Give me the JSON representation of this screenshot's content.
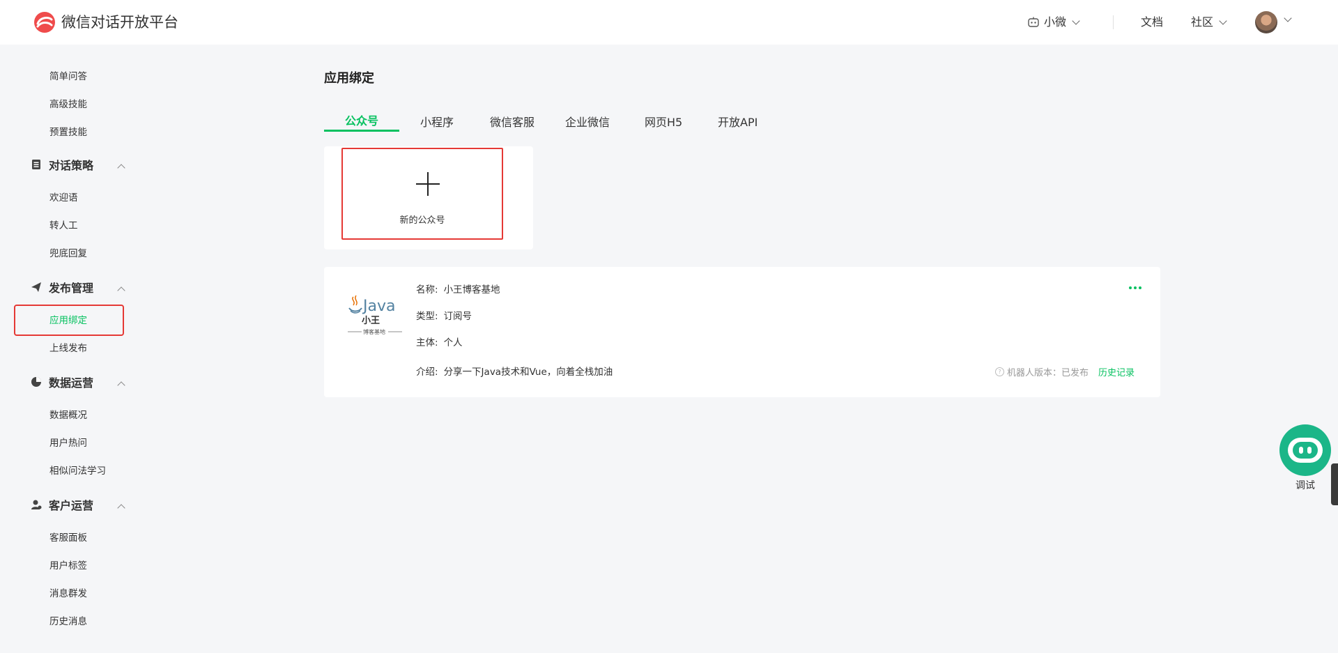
{
  "header": {
    "brand": "微信对话开放平台",
    "bot_name": "小微",
    "docs": "文档",
    "community": "社区"
  },
  "sidebar": {
    "top_items": [
      "简单问答",
      "高级技能",
      "预置技能"
    ],
    "sections": [
      {
        "title": "对话策略",
        "items": [
          "欢迎语",
          "转人工",
          "兜底回复"
        ]
      },
      {
        "title": "发布管理",
        "items": [
          "应用绑定",
          "上线发布"
        ]
      },
      {
        "title": "数据运营",
        "items": [
          "数据概况",
          "用户热问",
          "相似问法学习"
        ]
      },
      {
        "title": "客户运营",
        "items": [
          "客服面板",
          "用户标签",
          "消息群发",
          "历史消息"
        ]
      }
    ],
    "active_item": "应用绑定"
  },
  "main": {
    "title": "应用绑定",
    "tabs": [
      "公众号",
      "小程序",
      "微信客服",
      "企业微信",
      "网页H5",
      "开放API"
    ],
    "active_tab": "公众号",
    "new_account_label": "新的公众号",
    "account": {
      "logo_text": "Java",
      "logo_sub": "小王",
      "logo_caption": "博客基地",
      "name_key": "名称:",
      "name": "小王博客基地",
      "type_key": "类型:",
      "type": "订阅号",
      "subject_key": "主体:",
      "subject": "个人",
      "intro_key": "介绍:",
      "intro": "分享一下Java技术和Vue，向着全栈加油",
      "version_label": "机器人版本：已发布",
      "history": "历史记录"
    }
  },
  "debug_bot": {
    "label": "调试"
  },
  "colors": {
    "accent": "#07c160",
    "highlight": "#e53935",
    "bot": "#1bb688"
  }
}
